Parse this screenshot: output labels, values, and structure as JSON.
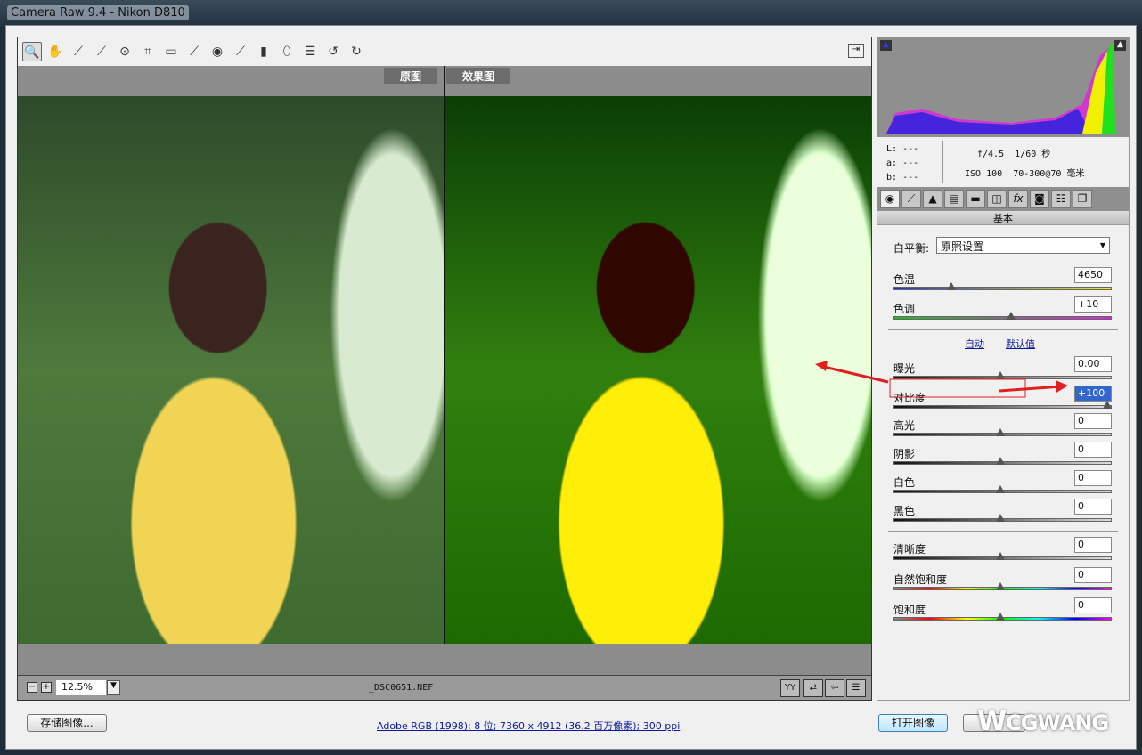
{
  "window": {
    "title": "Camera Raw 9.4 -  Nikon D810"
  },
  "toolbar": {
    "tools": [
      {
        "icon": "zoom-icon",
        "g": "🔍"
      },
      {
        "icon": "hand-icon",
        "g": "✋"
      },
      {
        "icon": "white-balance-icon",
        "g": "⟋"
      },
      {
        "icon": "color-sampler-icon",
        "g": "⟋"
      },
      {
        "icon": "target-adjust-icon",
        "g": "⊙"
      },
      {
        "icon": "crop-icon",
        "g": "⌗"
      },
      {
        "icon": "straighten-icon",
        "g": "▭"
      },
      {
        "icon": "spot-removal-icon",
        "g": "⟋"
      },
      {
        "icon": "red-eye-icon",
        "g": "◉"
      },
      {
        "icon": "adjustment-brush-icon",
        "g": "⟋"
      },
      {
        "icon": "graduated-filter-icon",
        "g": "▮"
      },
      {
        "icon": "radial-filter-icon",
        "g": "⬯"
      },
      {
        "icon": "preferences-icon",
        "g": "☰"
      },
      {
        "icon": "rotate-left-icon",
        "g": "↺"
      },
      {
        "icon": "rotate-right-icon",
        "g": "↻"
      }
    ],
    "fullscreen_icon": "exit-icon"
  },
  "preview": {
    "before_label": "原图",
    "after_label": "效果图"
  },
  "status": {
    "zoom": "12.5%",
    "filename": "_DSC0651.NEF"
  },
  "histogram": {
    "colors": {
      "blue": "#2020e0",
      "magenta": "#e020e0",
      "yellow": "#f0f000",
      "green": "#20e020"
    }
  },
  "info": {
    "L": "---",
    "a": "---",
    "b": "---",
    "aperture": "f/4.5",
    "shutter": "1/60 秒",
    "iso": "ISO 100",
    "lens": "70-300@70 毫米",
    "L_label": "L:",
    "a_label": "a:",
    "b_label": "b:"
  },
  "panel": {
    "title": "基本",
    "wb_label": "白平衡:",
    "wb_value": "原照设置",
    "auto": "自动",
    "default": "默认值",
    "sliders": [
      {
        "label": "色温",
        "value": "4650",
        "pos": 0.27
      },
      {
        "label": "色调",
        "value": "+10",
        "pos": 0.55
      },
      {
        "label": "曝光",
        "value": "0.00",
        "pos": 0.5
      },
      {
        "label": "对比度",
        "value": "+100",
        "pos": 1.0
      },
      {
        "label": "高光",
        "value": "0",
        "pos": 0.5
      },
      {
        "label": "阴影",
        "value": "0",
        "pos": 0.5
      },
      {
        "label": "白色",
        "value": "0",
        "pos": 0.5
      },
      {
        "label": "黑色",
        "value": "0",
        "pos": 0.5
      },
      {
        "label": "清晰度",
        "value": "0",
        "pos": 0.5
      },
      {
        "label": "自然饱和度",
        "value": "0",
        "pos": 0.5
      },
      {
        "label": "饱和度",
        "value": "0",
        "pos": 0.5
      }
    ]
  },
  "footer": {
    "save": "存储图像...",
    "info_link": "Adobe RGB (1998); 8 位; 7360 x 4912 (36.2 百万像素); 300 ppi",
    "open": "打开图像",
    "watermark": "CGWANG"
  }
}
